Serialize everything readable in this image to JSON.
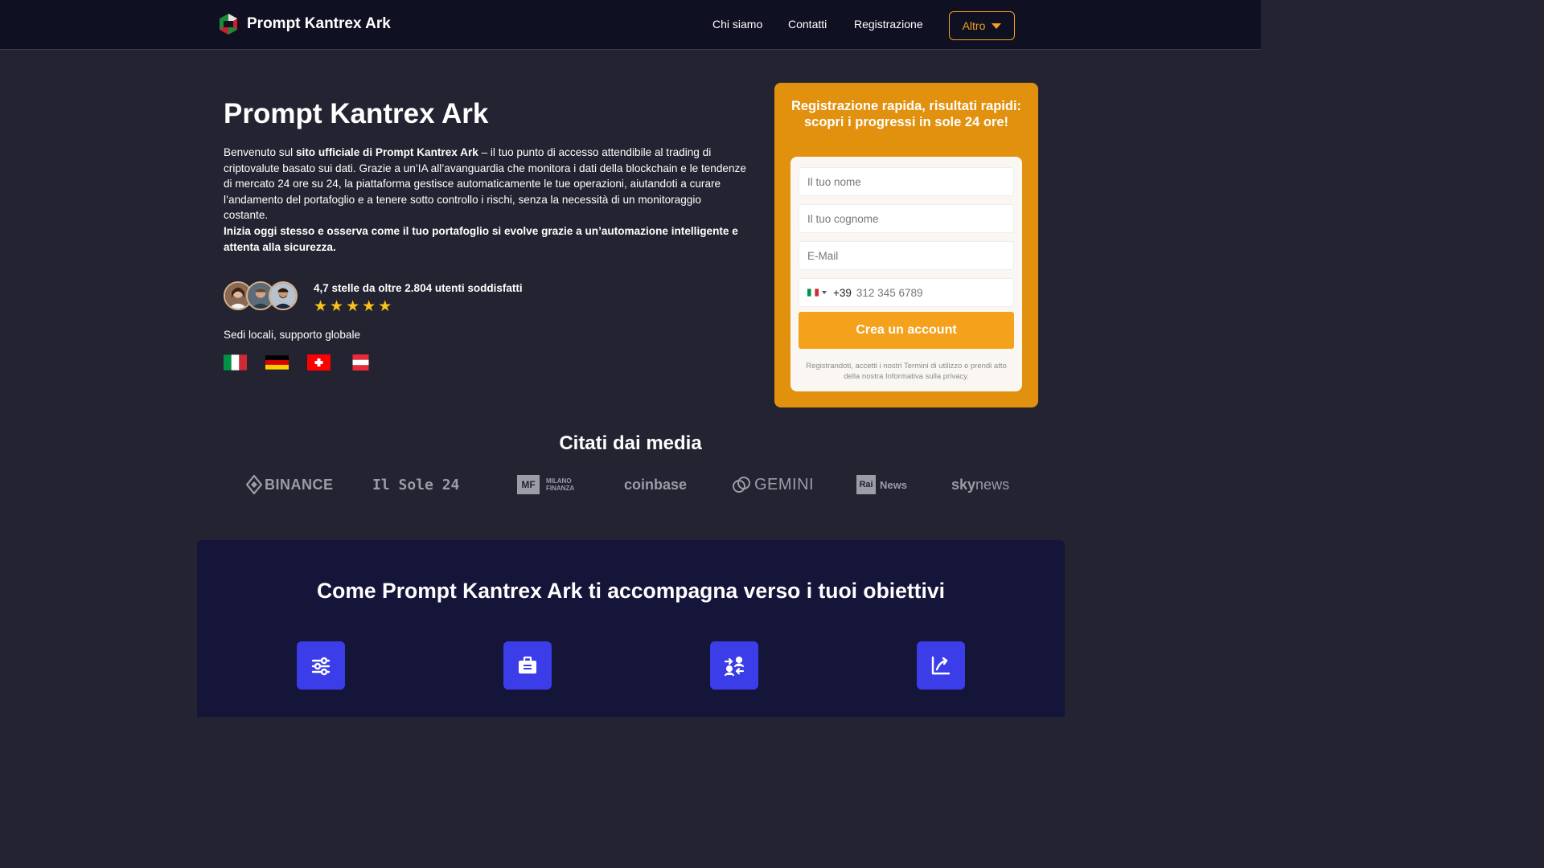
{
  "header": {
    "brand": "Prompt Kantrex Ark",
    "nav": [
      "Chi siamo",
      "Contatti",
      "Registrazione"
    ],
    "more_label": "Altro"
  },
  "hero": {
    "title": "Prompt Kantrex Ark",
    "intro_1": "Benvenuto sul ",
    "intro_bold": "sito ufficiale di Prompt Kantrex Ark",
    "intro_2": " – il tuo punto di accesso attendibile al trading di criptovalute basato sui dati. Grazie a un’IA all’avanguardia che monitora i dati della blockchain e le tendenze di mercato 24 ore su 24, la piattaforma gestisce automaticamente le tue operazioni, aiutandoti a curare l’andamento del portafoglio e a tenere sotto controllo i rischi, senza la necessità di un monitoraggio costante.",
    "cta_bold": "Inizia oggi stesso e osserva come il tuo portafoglio si evolve grazie a un’automazione intelligente e attenta alla sicurezza.",
    "rating_text": "4,7 stelle da oltre 2.804 utenti soddisfatti",
    "stars": 5,
    "locations_label": "Sedi locali, supporto globale",
    "flags": [
      "italy",
      "germany",
      "switzerland",
      "austria"
    ]
  },
  "form": {
    "title": "Registrazione rapida, risultati rapidi: scopri i progressi in sole 24 ore!",
    "first_name_placeholder": "Il tuo nome",
    "last_name_placeholder": "Il tuo cognome",
    "email_placeholder": "E-Mail",
    "phone_code": "+39",
    "phone_placeholder": "312 345 6789",
    "submit_label": "Crea un account",
    "disclaimer": "Registrandoti, accetti i nostri Termini di utilizzo e prendi atto della nostra Informativa sulla privacy."
  },
  "media": {
    "title": "Citati dai media",
    "logos": {
      "binance": "BINANCE",
      "sole": "Il Sole 24",
      "mf_box": "MF",
      "mf_line1": "MILANO",
      "mf_line2": "FINANZA",
      "coinbase": "coinbase",
      "gemini": "GEMINI",
      "rai_box": "Rai",
      "rai_text": "News",
      "sky_a": "sky",
      "sky_b": "news"
    }
  },
  "objectives": {
    "title": "Come Prompt Kantrex Ark ti accompagna verso i tuoi obiettivi",
    "icons": [
      "sliders-icon",
      "briefcase-icon",
      "exchange-icon",
      "chart-growth-icon"
    ]
  },
  "colors": {
    "accent": "#f2a01e",
    "card": "#e2910f",
    "nav_bg": "#0f1022",
    "page_bg": "#232331",
    "objectives_bg": "#151439",
    "icon_bg": "#3b3ee8"
  }
}
